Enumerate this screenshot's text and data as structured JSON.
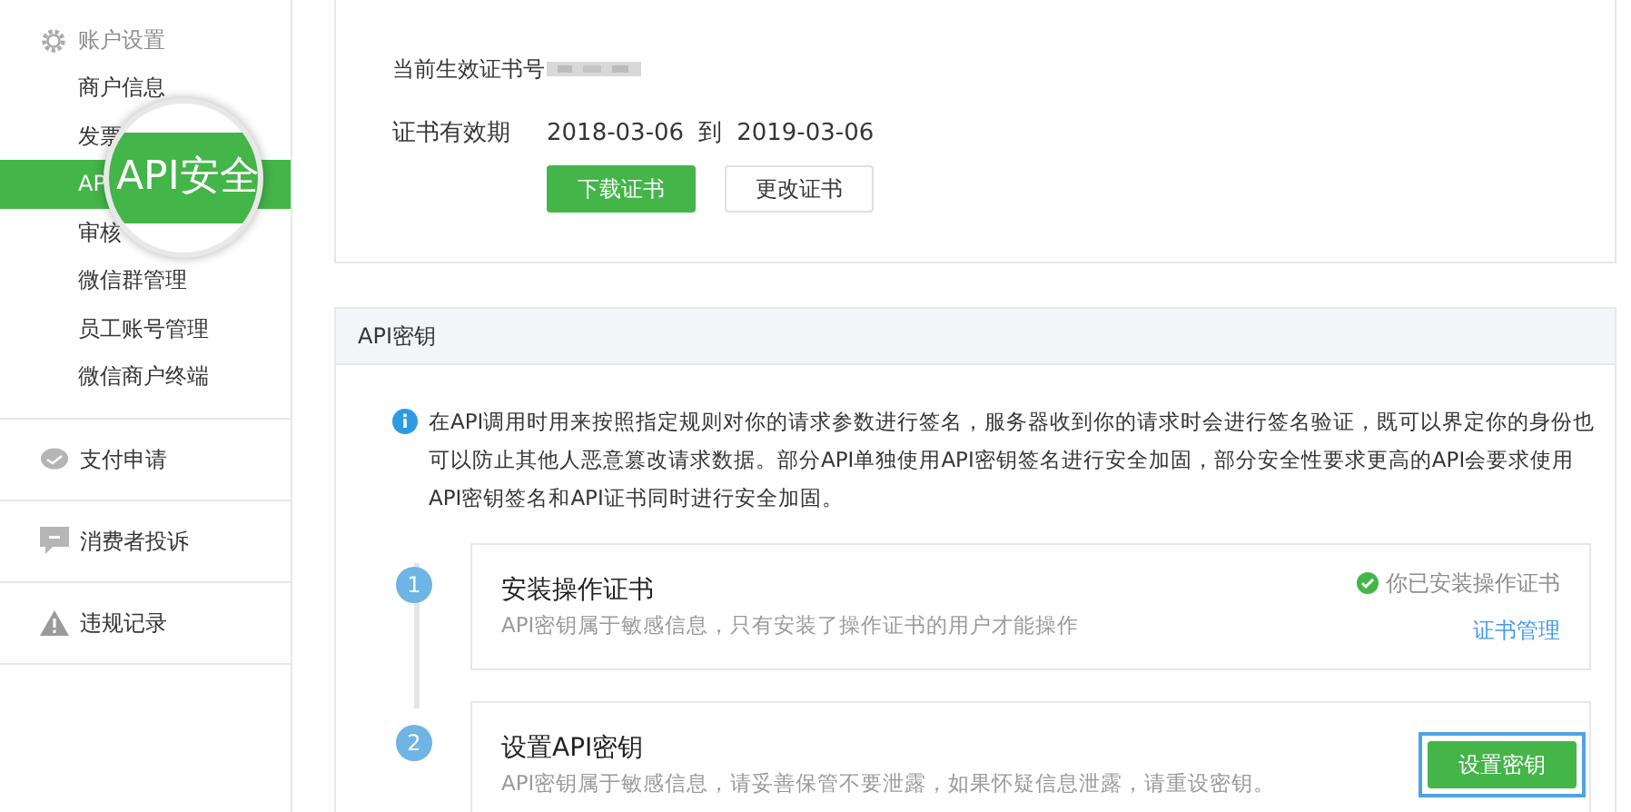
{
  "sidebar": {
    "sections": [
      {
        "label": "账户设置",
        "children": [
          {
            "label": "商户信息",
            "selected": false
          },
          {
            "label": "发票",
            "selected": false
          },
          {
            "label": "AP",
            "selected": true
          },
          {
            "label": "审核",
            "selected": false
          },
          {
            "label": "微信群管理",
            "selected": false
          },
          {
            "label": "员工账号管理",
            "selected": false
          },
          {
            "label": "微信商户终端",
            "selected": false
          }
        ]
      },
      {
        "label": "支付申请"
      },
      {
        "label": "消费者投诉"
      },
      {
        "label": "违规记录"
      }
    ],
    "magnifier": {
      "text": "API安全"
    }
  },
  "certificate": {
    "rows": [
      {
        "label": "当前生效证书号",
        "kind": "blurred"
      },
      {
        "label": "证书有效期",
        "kind": "range",
        "from": "2018-03-06",
        "separator": "到",
        "to": "2019-03-06"
      }
    ],
    "buttons": [
      {
        "label": "下载证书",
        "primary": true
      },
      {
        "label": "更改证书",
        "primary": false
      }
    ]
  },
  "api_key": {
    "title": "API密钥",
    "notice": "在API调用时用来按照指定规则对你的请求参数进行签名，服务器收到你的请求时会进行签名验证，既可以界定你的身份也可以防止其他人恶意篡改请求数据。部分API单独使用API密钥签名进行安全加固，部分安全性要求更高的API会要求使用API密钥签名和API证书同时进行安全加固。",
    "steps": [
      {
        "number": "1",
        "title": "安装操作证书",
        "description": "API密钥属于敏感信息，只有安装了操作证书的用户才能操作",
        "kind": "status",
        "status": "你已安装操作证书",
        "link": "证书管理"
      },
      {
        "number": "2",
        "title": "设置API密钥",
        "description": "API密钥属于敏感信息，请妥善保管不要泄露，如果怀疑信息泄露，请重设密钥。",
        "kind": "action",
        "button": "设置密钥",
        "highlighted": true
      }
    ]
  }
}
